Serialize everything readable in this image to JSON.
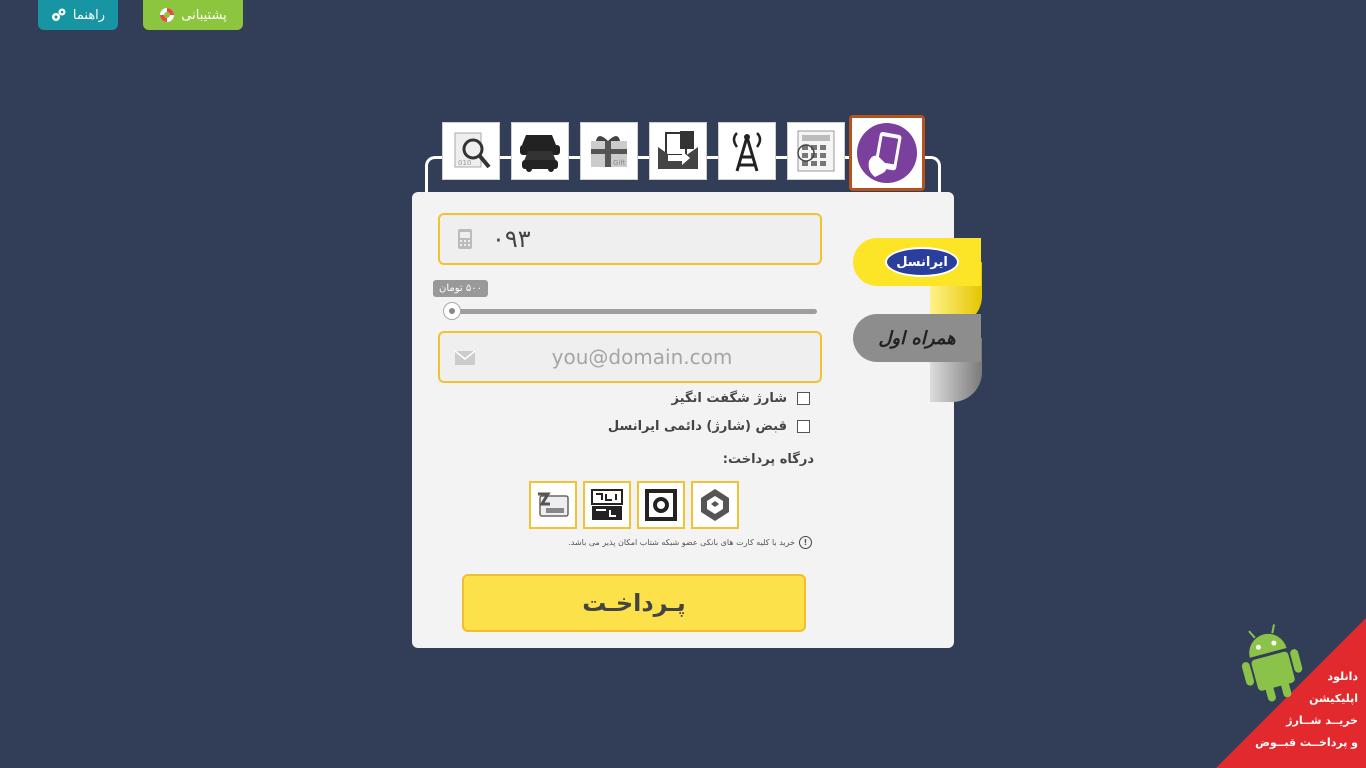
{
  "header": {
    "help_label": "راهنما",
    "support_label": "پشتیبانی"
  },
  "tabs": [
    {
      "name": "mobile-topup",
      "icon": "mobile-hand-icon",
      "active": true
    },
    {
      "name": "bill-calculator",
      "icon": "calculator-icon",
      "active": false
    },
    {
      "name": "internet-package",
      "icon": "antenna-icon",
      "active": false
    },
    {
      "name": "sms",
      "icon": "mail-icon",
      "active": false
    },
    {
      "name": "gift-card",
      "icon": "gift-icon",
      "active": false
    },
    {
      "name": "traffic-fines",
      "icon": "cars-icon",
      "active": false
    },
    {
      "name": "tracking",
      "icon": "search-document-icon",
      "active": false
    }
  ],
  "form": {
    "phone_value": "۰۹۳",
    "amount_label": "۵۰۰ تومان",
    "amount_fraction": 0.0,
    "email_placeholder": "you@domain.com",
    "checkbox1_label": "شارژ شگفت انگیز",
    "checkbox2_label": "قبض (شارژ) دائمی ایرانسل",
    "gateway_label": "درگاه پرداخت:",
    "note": "خرید با کلیه کارت های بانکی عضو شبکه شتاب امکان پذیر می باشد.",
    "pay_button": "پـرداخـت"
  },
  "operators": {
    "irancell": "ایرانسل",
    "mci": "همراه اول"
  },
  "promo": {
    "line1": "دانلود",
    "line2": "اپلیکیشن",
    "line3": "خریــد شــارژ",
    "line4": "و پرداخــت قبــوض"
  },
  "colors": {
    "background": "#323d57",
    "accent_yellow": "#f2c232",
    "help_teal": "#1795a2",
    "support_green": "#8cc63f",
    "promo_red": "#e22a2e"
  }
}
